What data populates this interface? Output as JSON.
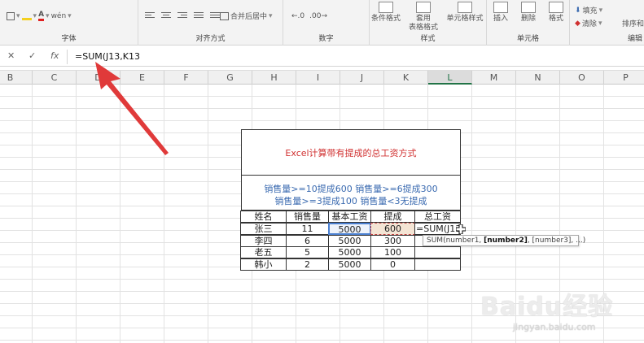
{
  "ribbon": {
    "groups": {
      "font": "字体",
      "align": "对齐方式",
      "number": "数字",
      "styles": "样式",
      "cells": "单元格",
      "editing": "编辑"
    },
    "merge_label": "合并后居中",
    "cond_format": "条件格式",
    "table_format_line1": "套用",
    "table_format_line2": "表格格式",
    "cell_styles": "单元格样式",
    "insert": "插入",
    "delete": "删除",
    "format": "格式",
    "fill": "填充",
    "clear": "清除",
    "sort_filter": "排序和"
  },
  "formula_bar": {
    "cancel": "✕",
    "enter": "✓",
    "fx": "fx",
    "formula": "=SUM(J13,K13"
  },
  "columns": [
    "B",
    "C",
    "D",
    "E",
    "F",
    "G",
    "H",
    "I",
    "J",
    "K",
    "L",
    "M",
    "N",
    "O",
    "P"
  ],
  "selected_column": "L",
  "table": {
    "title": "Excel计算带有提成的总工资方式",
    "desc_line1": "销售量>=10提成600  销售量>=6提成300",
    "desc_line2": "销售量>=3提成100  销售量<3无提成",
    "headers": [
      "姓名",
      "销售量",
      "基本工资",
      "提成",
      "总工资"
    ],
    "rows": [
      {
        "name": "张三",
        "qty": "11",
        "base": "5000",
        "bonus": "600",
        "total": "=SUM(J13"
      },
      {
        "name": "李四",
        "qty": "6",
        "base": "5000",
        "bonus": "300",
        "total": ""
      },
      {
        "name": "老五",
        "qty": "5",
        "base": "5000",
        "bonus": "100",
        "total": ""
      },
      {
        "name": "韩小",
        "qty": "2",
        "base": "5000",
        "bonus": "0",
        "total": ""
      }
    ]
  },
  "tooltip": {
    "prefix": "SUM(number1, ",
    "bold": "[number2]",
    "suffix": ", [number3], ...)"
  },
  "watermark": {
    "main": "Baidu经验",
    "sub": "jingyan.baidu.com"
  },
  "colors": {
    "title_red": "#d03030",
    "desc_blue": "#3a6ab0",
    "arrow_red": "#e03a3a",
    "selection_blue": "#4a7fd0"
  }
}
